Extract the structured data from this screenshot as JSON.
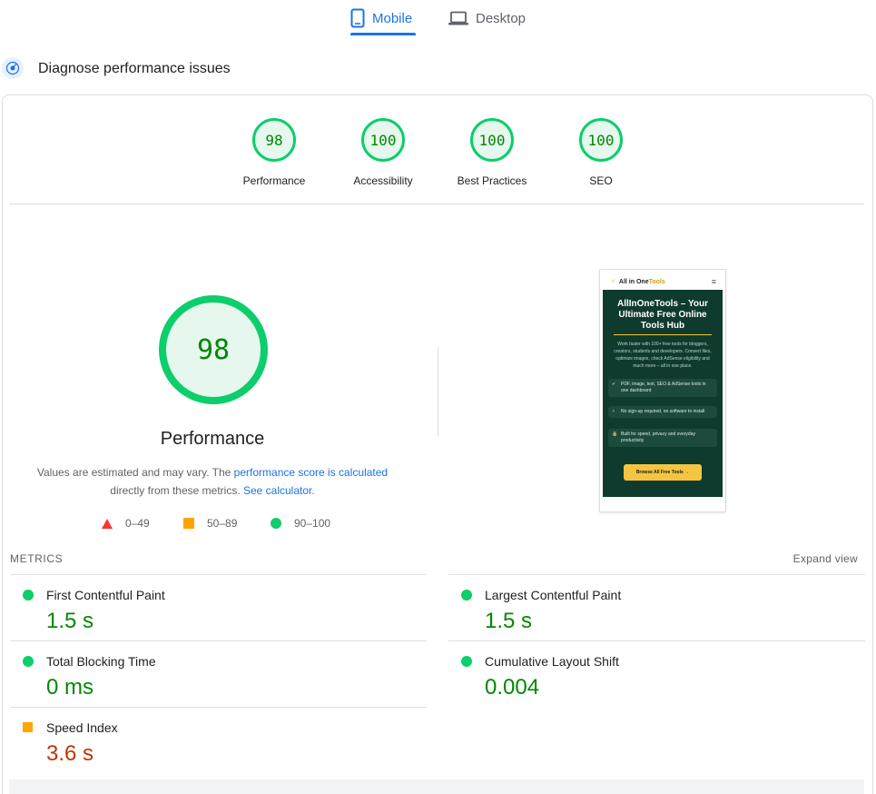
{
  "tabs": [
    {
      "label": "Mobile",
      "active": true
    },
    {
      "label": "Desktop",
      "active": false
    }
  ],
  "diagnose": {
    "title": "Diagnose performance issues"
  },
  "categories": [
    {
      "score": "98",
      "label": "Performance"
    },
    {
      "score": "100",
      "label": "Accessibility"
    },
    {
      "score": "100",
      "label": "Best Practices"
    },
    {
      "score": "100",
      "label": "SEO"
    }
  ],
  "main_gauge": {
    "score": "98",
    "label": "Performance"
  },
  "note": {
    "text1": "Values are estimated and may vary. The ",
    "link1": "performance score is calculated",
    "text2": "directly from these metrics. ",
    "link2": "See calculator."
  },
  "legend": [
    {
      "range": "0–49",
      "color": "#ff3333"
    },
    {
      "range": "50–89",
      "color": "#ffa400"
    },
    {
      "range": "90–100",
      "color": "#0cce6b"
    }
  ],
  "screenshot": {
    "brand_prefix": "All in One",
    "brand_accent": "Tools",
    "title": "AllInOneTools – Your Ultimate Free Online Tools Hub",
    "description": "Work faster with 100+ free tools for bloggers, creators, students and developers. Convert files, optimize images, check AdSense eligibility and much more – all in one place.",
    "features": [
      "PDF, image, text, SEO & AdSense tools in one dashboard",
      "No sign-up required, no software to install",
      "Built for speed, privacy and everyday productivity"
    ],
    "button": "Browse All Free Tools →"
  },
  "metrics": {
    "header": "METRICS",
    "expand": "Expand view",
    "items": [
      {
        "name": "First Contentful Paint",
        "value": "1.5 s",
        "rating": "good"
      },
      {
        "name": "Largest Contentful Paint",
        "value": "1.5 s",
        "rating": "good"
      },
      {
        "name": "Total Blocking Time",
        "value": "0 ms",
        "rating": "good"
      },
      {
        "name": "Cumulative Layout Shift",
        "value": "0.004",
        "rating": "good"
      },
      {
        "name": "Speed Index",
        "value": "3.6 s",
        "rating": "average"
      }
    ]
  },
  "colors": {
    "good": "#0cce6b",
    "average": "#ffa400",
    "poor": "#ff3333",
    "accent": "#1a73e8"
  }
}
